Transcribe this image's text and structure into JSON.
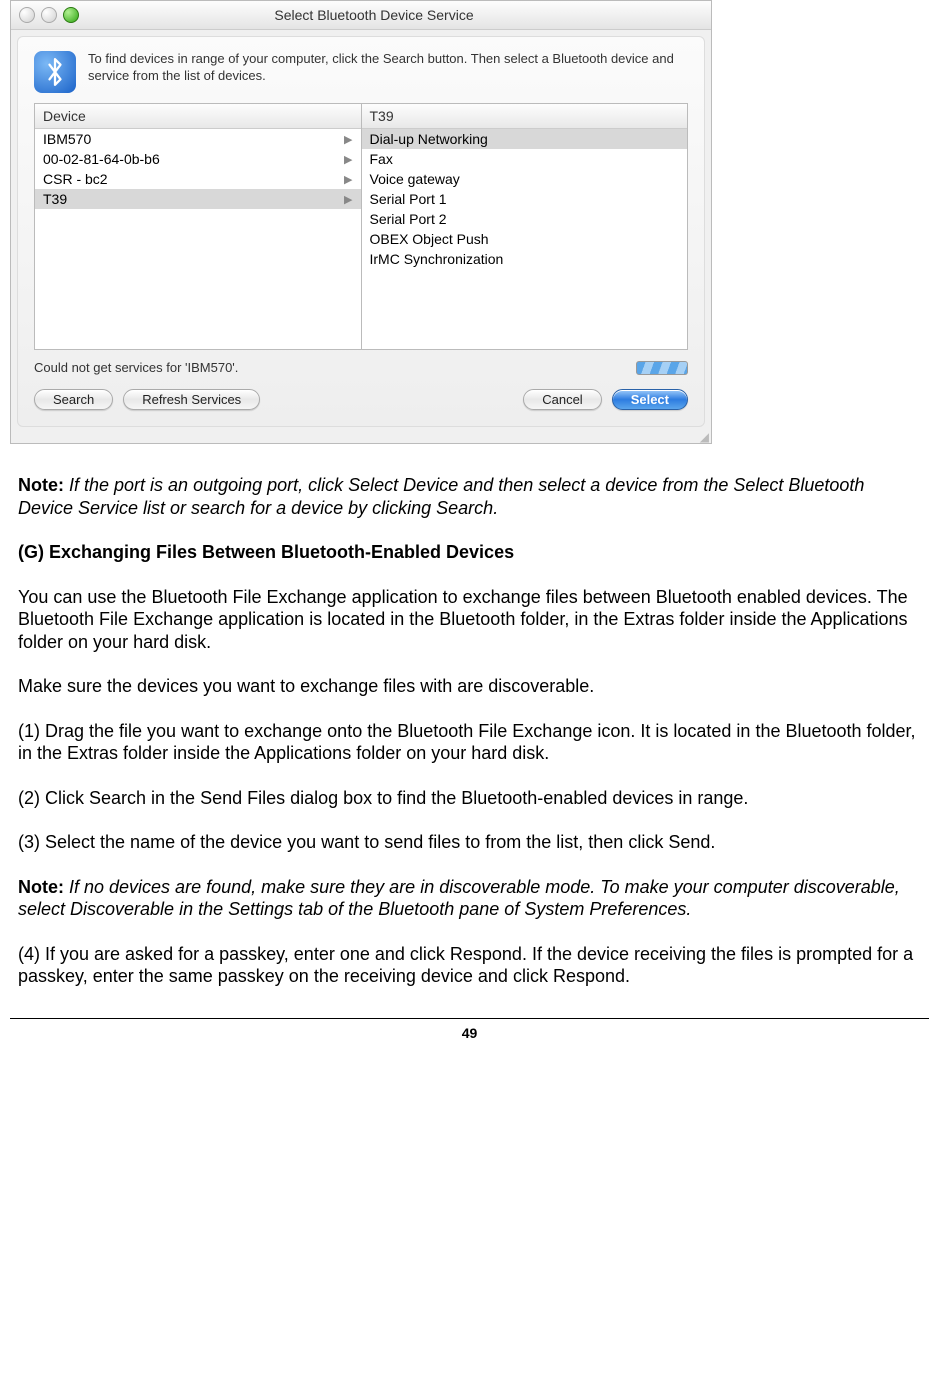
{
  "dialog": {
    "title": "Select Bluetooth Device Service",
    "instruction": "To find devices in range of your computer, click the Search button. Then select a Bluetooth device and service from the list of devices.",
    "device_header": "Device",
    "service_header": "T39",
    "devices": [
      {
        "name": "IBM570",
        "selected": false
      },
      {
        "name": "00-02-81-64-0b-b6",
        "selected": false
      },
      {
        "name": "CSR - bc2",
        "selected": false
      },
      {
        "name": "T39",
        "selected": true
      }
    ],
    "services": [
      {
        "name": "Dial-up Networking",
        "selected": true
      },
      {
        "name": "Fax",
        "selected": false
      },
      {
        "name": "Voice gateway",
        "selected": false
      },
      {
        "name": "Serial Port 1",
        "selected": false
      },
      {
        "name": "Serial Port 2",
        "selected": false
      },
      {
        "name": "OBEX Object Push",
        "selected": false
      },
      {
        "name": "IrMC Synchronization",
        "selected": false
      }
    ],
    "status_text": "Could not get services for 'IBM570'.",
    "buttons": {
      "search": "Search",
      "refresh": "Refresh Services",
      "cancel": "Cancel",
      "select": "Select"
    }
  },
  "doc": {
    "note1_label": "Note:",
    "note1_text": " If the port is an outgoing port, click Select Device and then select a device from the Select Bluetooth Device Service list or search for a device by clicking Search.",
    "section_heading": "(G) Exchanging Files Between Bluetooth-Enabled Devices",
    "para1": "You can use the Bluetooth File Exchange application to exchange files between Bluetooth enabled devices. The Bluetooth File Exchange application is located in the Bluetooth folder, in the Extras folder inside the Applications folder on your hard disk.",
    "para2": "Make sure the devices you want to exchange files with are discoverable.",
    "step1": "(1) Drag the file you want to exchange onto the Bluetooth File Exchange icon. It is located in the Bluetooth folder, in the Extras folder inside the Applications folder on your hard disk.",
    "step2": "(2) Click Search in the Send Files dialog box to find the Bluetooth-enabled devices in range.",
    "step3": "(3) Select the name of the device you want to send files to from the list, then click Send.",
    "note2_label": "Note:",
    "note2_text": " If no devices are found, make sure they are in discoverable mode. To make your computer discoverable, select Discoverable in the Settings tab of the Bluetooth pane of System Preferences.",
    "step4": "(4) If you are asked for a passkey, enter one and click Respond. If the device receiving the files is prompted for a passkey, enter the same passkey on the receiving device and click Respond.",
    "page_number": "49"
  }
}
